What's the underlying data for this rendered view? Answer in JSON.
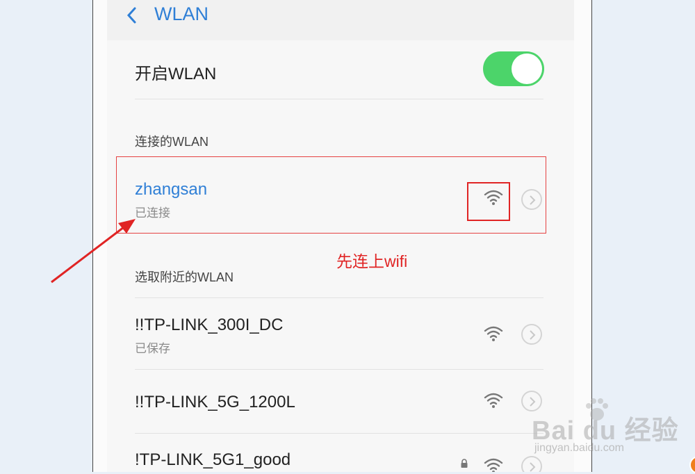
{
  "header": {
    "title": "WLAN",
    "back_icon": "chevron-left-icon"
  },
  "toggle_row": {
    "label": "开启WLAN",
    "enabled": true
  },
  "connected_section": {
    "label": "连接的WLAN",
    "network": {
      "ssid": "zhangsan",
      "status": "已连接"
    }
  },
  "annotation": {
    "text": "先连上wifi"
  },
  "nearby_section": {
    "label": "选取附近的WLAN",
    "networks": [
      {
        "ssid": "!!TP-LINK_300I_DC",
        "status": "已保存",
        "locked": false
      },
      {
        "ssid": "!!TP-LINK_5G_1200L",
        "status": "",
        "locked": false
      },
      {
        "ssid": "!TP-LINK_5G1_good",
        "status": "",
        "locked": true
      }
    ]
  },
  "watermark": {
    "brand": "Bai du 经验",
    "url": "jingyan.baidu.com"
  },
  "colors": {
    "accent": "#2f7fd6",
    "toggle_on": "#4cd46a",
    "annotation": "#e02424"
  }
}
